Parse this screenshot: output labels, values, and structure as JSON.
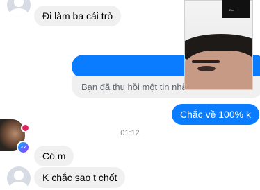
{
  "messages": {
    "incoming_1": "Đi làm ba cái trò",
    "recalled_notice": "Bạn đã thu hồi một tin nhắn",
    "outgoing_1": "Chắc về 100% k",
    "timestamp": "01:12",
    "incoming_2": "Có m",
    "incoming_3": "K chắc sao t chốt"
  },
  "video_call": {
    "pip_label": "Bạn"
  },
  "colors": {
    "outgoing_bubble": "#0a7cff",
    "incoming_bubble": "#f0f0f0",
    "timestamp_text": "#8a8d91"
  },
  "icons": [
    "user-avatar-icon",
    "messenger-icon"
  ]
}
